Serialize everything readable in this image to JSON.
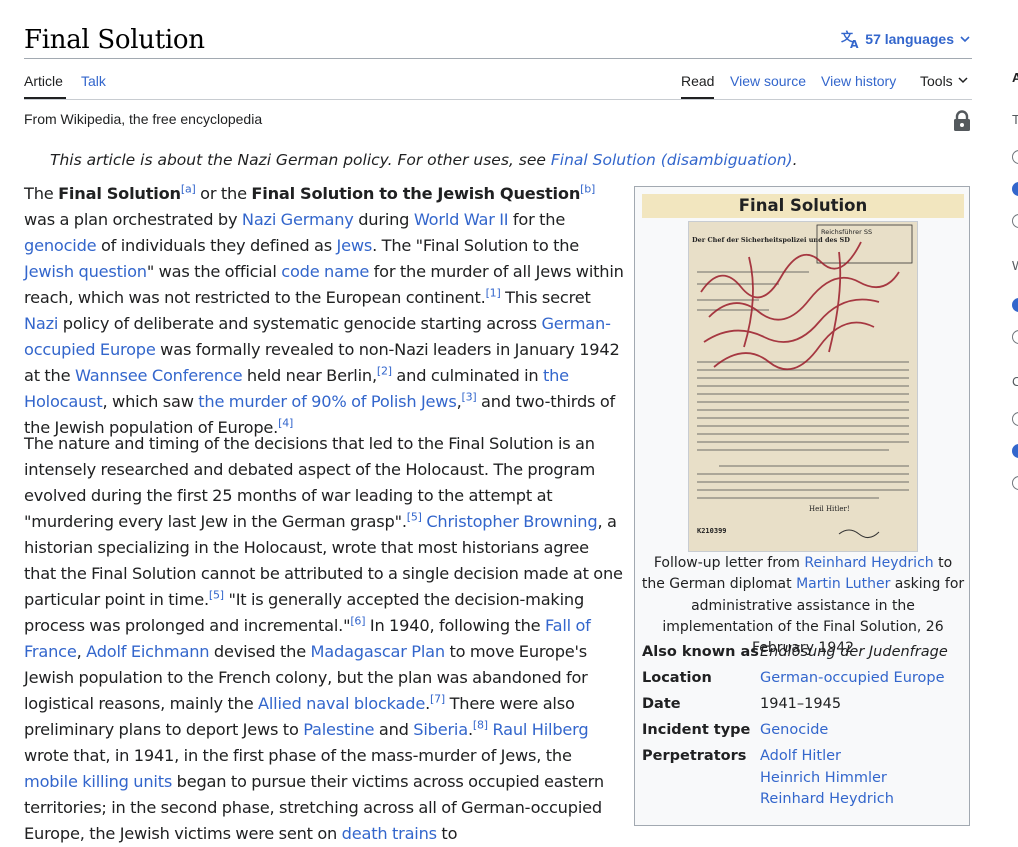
{
  "page": {
    "title": "Final Solution",
    "languages_label": "57 languages"
  },
  "tabs": {
    "article": "Article",
    "talk": "Talk",
    "read": "Read",
    "view_source": "View source",
    "view_history": "View history",
    "tools": "Tools"
  },
  "tagline": "From Wikipedia, the free encyclopedia",
  "hatnote": {
    "text": "This article is about the Nazi German policy. For other uses, see ",
    "link": "Final Solution (disambiguation)",
    "end": "."
  },
  "paragraph1": {
    "t0": "The ",
    "b0": "Final Solution",
    "r0": "[a]",
    "t1": " or the ",
    "b1": "Final Solution to the Jewish Question",
    "r1": "[b]",
    "t2": " was a plan orchestrated by ",
    "l_nazi_germany": "Nazi Germany",
    "t3": " during ",
    "l_ww2": "World War II",
    "t4": " for the ",
    "l_genocide": "genocide",
    "t5": " of individuals they defined as ",
    "l_jews": "Jews",
    "t6": ". The \"Final Solution to the ",
    "l_jewish_question": "Jewish question",
    "t7": "\" was the official ",
    "l_code_name": "code name",
    "t8": " for the murder of all Jews within reach, which was not restricted to the European continent.",
    "r2": "[1]",
    "t9": " This secret ",
    "l_nazi": "Nazi",
    "t10": " policy of deliberate and systematic genocide starting across ",
    "l_occupied_europe": "German-occupied Europe",
    "t11": " was formally revealed to non-Nazi leaders in January 1942 at the ",
    "l_wannsee": "Wannsee Conference",
    "t12": " held near Berlin,",
    "r3": "[2]",
    "t13": " and culminated in ",
    "l_holocaust": "the Holocaust",
    "t14": ", which saw ",
    "l_murder_polish": "the murder of 90% of Polish Jews",
    "t15": ",",
    "r4": "[3]",
    "t16": " and two-thirds of the Jewish population of Europe.",
    "r5": "[4]"
  },
  "paragraph2": {
    "t0": "The nature and timing of the decisions that led to the Final Solution is an intensely researched and debated aspect of the Holocaust. The program evolved during the first 25 months of war leading to the attempt at \"murdering every last Jew in the German grasp\".",
    "r0": "[5]",
    "t1": " ",
    "l_browning": "Christopher Browning",
    "t2": ", a historian specializing in the Holocaust, wrote that most historians agree that the Final Solution cannot be attributed to a single decision made at one particular point in time.",
    "r1": "[5]",
    "t3": " \"It is generally accepted the decision-making process was prolonged and incremental.\"",
    "r2": "[6]",
    "t4": " In 1940, following the ",
    "l_fall_france": "Fall of France",
    "t5": ", ",
    "l_eichmann": "Adolf Eichmann",
    "t6": " devised the ",
    "l_madagascar": "Madagascar Plan",
    "t7": " to move Europe's Jewish population to the French colony, but the plan was abandoned for logistical reasons, mainly the ",
    "l_blockade": "Allied naval blockade",
    "t8": ".",
    "r3": "[7]",
    "t9": " There were also preliminary plans to deport Jews to ",
    "l_palestine": "Palestine",
    "t10": " and ",
    "l_siberia": "Siberia",
    "t11": ".",
    "r4": "[8]",
    "t12": " ",
    "l_hilberg": "Raul Hilberg",
    "t13": " wrote that, in 1941, in the first phase of the mass-murder of Jews, the ",
    "l_mobile_units": "mobile killing units",
    "t14": " began to pursue their victims across occupied eastern territories; in the second phase, stretching across all of German-occupied Europe, the Jewish victims were sent on ",
    "l_death_trains": "death trains",
    "t15": " to"
  },
  "infobox": {
    "title": "Final Solution",
    "image_header_left": "Der Chef der Sicherheitspolizei und des SD",
    "image_stamp": "Reichsführer SS",
    "image_number": "K210399",
    "image_signoff": "Heil Hitler!",
    "caption": {
      "t0": "Follow-up letter from ",
      "l0": "Reinhard Heydrich",
      "t1": " to the German diplomat ",
      "l1": "Martin Luther",
      "t2": " asking for administrative assistance in the implementation of the Final Solution, 26 February 1942"
    },
    "rows": [
      {
        "label": "Also known as",
        "value": "Endlösung der Judenfrage"
      },
      {
        "label": "Location",
        "value": "German-occupied Europe"
      },
      {
        "label": "Date",
        "value": "1941–1945"
      },
      {
        "label": "Incident type",
        "value": "Genocide"
      },
      {
        "label": "Perpetrators",
        "values": [
          "Adolf Hitler",
          "Heinrich Himmler",
          "Reinhard Heydrich"
        ]
      }
    ]
  },
  "side_panel": {
    "letters": [
      "A",
      "T",
      "W",
      "C"
    ]
  },
  "colors": {
    "link": "#3366cc",
    "text": "#202122",
    "infobox_title_bg": "#f2e6bf",
    "infobox_bg": "#f8f9fa"
  },
  "icons": [
    "translate-icon",
    "chevron-down-icon",
    "lock-icon"
  ]
}
